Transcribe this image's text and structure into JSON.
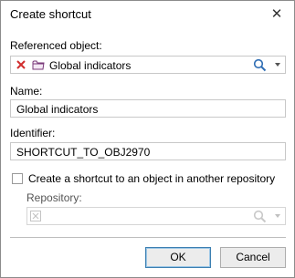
{
  "dialog": {
    "title": "Create shortcut",
    "close_symbol": "✕"
  },
  "referenced_object": {
    "label": "Referenced object:",
    "value": "Global indicators",
    "clear_icon": "red-x-icon",
    "object_icon": "folder-icon",
    "search_icon": "search-icon"
  },
  "name": {
    "label": "Name:",
    "value": "Global indicators"
  },
  "identifier": {
    "label": "Identifier:",
    "value": "SHORTCUT_TO_OBJ2970"
  },
  "other_repo": {
    "checkbox_label": "Create a shortcut to an object in another repository",
    "checked": false
  },
  "repository": {
    "label": "Repository:",
    "value": ""
  },
  "buttons": {
    "ok": "OK",
    "cancel": "Cancel"
  },
  "colors": {
    "clear_icon": "#d12e2e",
    "folder_icon": "#7a3a7a",
    "search_icon": "#2e6db4",
    "default_button_border": "#3c7fb1"
  }
}
